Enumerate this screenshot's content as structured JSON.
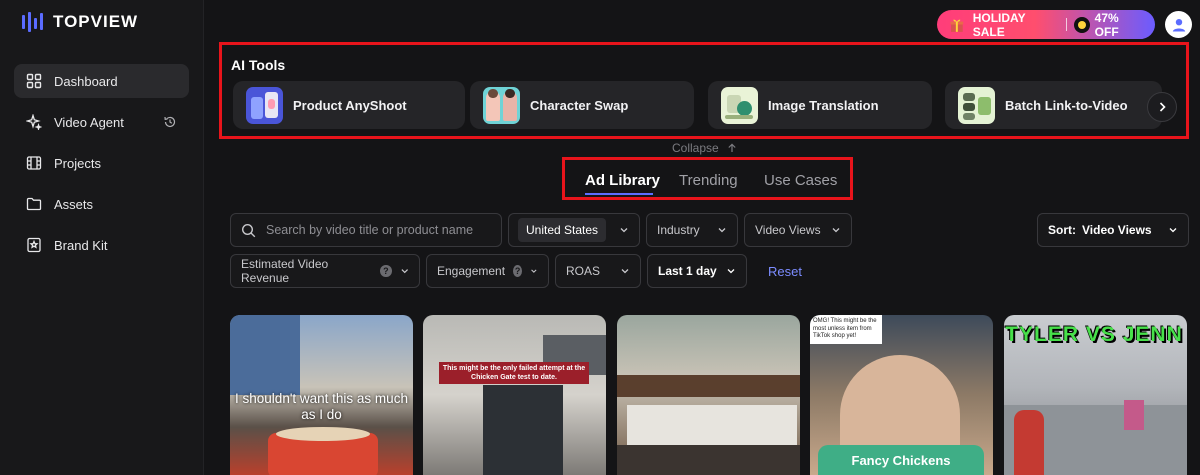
{
  "brand": {
    "name": "TOPVIEW",
    "accent": "#5b6cff"
  },
  "sidebar": {
    "items": [
      {
        "label": "Dashboard",
        "icon": "dashboard-grid-icon",
        "active": true
      },
      {
        "label": "Video Agent",
        "icon": "sparkle-icon",
        "extra_icon": "history-icon"
      },
      {
        "label": "Projects",
        "icon": "film-icon"
      },
      {
        "label": "Assets",
        "icon": "folder-icon"
      },
      {
        "label": "Brand Kit",
        "icon": "bookmark-icon"
      }
    ]
  },
  "promo": {
    "label": "HOLIDAY SALE",
    "discount": "47% OFF",
    "icon": "gift-icon"
  },
  "ai_tools": {
    "title": "AI Tools",
    "tools": [
      {
        "label": "Product AnyShoot"
      },
      {
        "label": "Character Swap"
      },
      {
        "label": "Image Translation"
      },
      {
        "label": "Batch Link-to-Video"
      }
    ],
    "collapse_label": "Collapse"
  },
  "tabs": [
    {
      "label": "Ad Library",
      "active": true
    },
    {
      "label": "Trending"
    },
    {
      "label": "Use Cases"
    }
  ],
  "filters": {
    "search_placeholder": "Search by video title or product name",
    "country": "United States",
    "industry": "Industry",
    "video_views": "Video Views",
    "sort_label": "Sort:",
    "sort_value": "Video Views",
    "revenue": "Estimated Video Revenue",
    "engagement": "Engagement",
    "roas": "ROAS",
    "period": "Last 1 day",
    "reset": "Reset"
  },
  "videos": [
    {
      "caption": "I shouldn't want this as much as I do"
    },
    {
      "caption": "This might be the only failed attempt at the Chicken Gate test to date."
    },
    {
      "caption": ""
    },
    {
      "caption": "OMG! This might be the most unless item from TikTok shop yet!",
      "overlay": "Fancy Chickens"
    },
    {
      "caption": "TYLER VS JENN"
    }
  ]
}
